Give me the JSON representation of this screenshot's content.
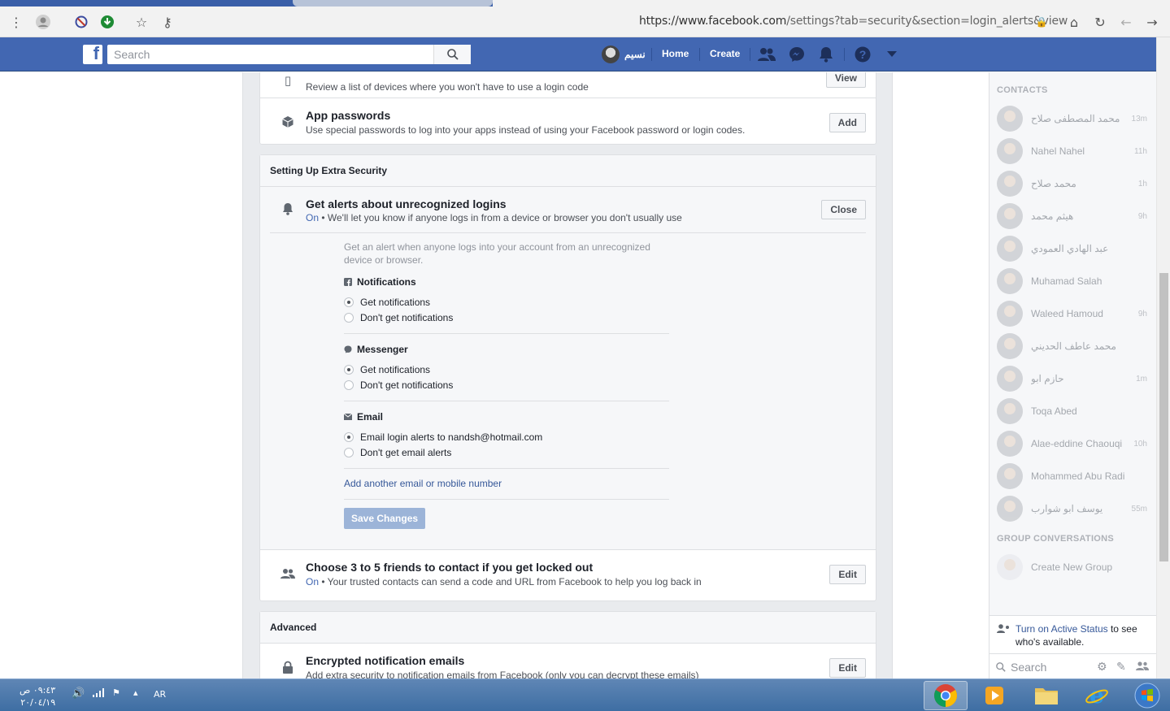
{
  "browser": {
    "url_main": "https://www.facebook.com",
    "url_rest": "/settings?tab=security&section=login_alerts&view"
  },
  "fb": {
    "search_placeholder": "Search",
    "profile_name": "نسيم",
    "nav_home": "Home",
    "nav_create": "Create"
  },
  "top_rows": [
    {
      "desc": "Review a list of devices where you won't have to use a login code",
      "button": "View"
    },
    {
      "title": "App passwords",
      "desc": "Use special passwords to log into your apps instead of using your Facebook password or login codes.",
      "button": "Add"
    }
  ],
  "extra_security": {
    "heading": "Setting Up Extra Security",
    "alerts_title": "Get alerts about unrecognized logins",
    "alerts_status": "On",
    "alerts_desc": " • We'll let you know if anyone logs in from a device or browser you don't usually use",
    "close_button": "Close",
    "intro": "Get an alert when anyone logs into your account from an unrecognized device or browser.",
    "notifications": {
      "title": "Notifications",
      "opt1": "Get notifications",
      "opt2": "Don't get notifications"
    },
    "messenger": {
      "title": "Messenger",
      "opt1": "Get notifications",
      "opt2": "Don't get notifications"
    },
    "email": {
      "title": "Email",
      "opt1": "Email login alerts to nandsh@hotmail.com",
      "opt2": "Don't get email alerts"
    },
    "add_link": "Add another email or mobile number",
    "save_button": "Save Changes",
    "trusted_title": "Choose 3 to 5 friends to contact if you get locked out",
    "trusted_status": "On",
    "trusted_desc": " • Your trusted contacts can send a code and URL from Facebook to help you log back in",
    "trusted_button": "Edit"
  },
  "advanced": {
    "heading": "Advanced",
    "enc_title": "Encrypted notification emails",
    "enc_desc": "Add extra security to notification emails from Facebook (only you can decrypt these emails)",
    "enc_button": "Edit"
  },
  "sidebar": {
    "contacts_heading": "CONTACTS",
    "contacts": [
      {
        "name": "محمد المصطفى صلاح",
        "time": "13m"
      },
      {
        "name": "Nahel Nahel",
        "time": "11h"
      },
      {
        "name": "محمد صلاح",
        "time": "1h"
      },
      {
        "name": "هيثم محمد",
        "time": "9h"
      },
      {
        "name": "عبد الهادي العمودي",
        "time": ""
      },
      {
        "name": "Muhamad Salah",
        "time": ""
      },
      {
        "name": "Waleed Hamoud",
        "time": "9h"
      },
      {
        "name": "محمد عاطف الحديني",
        "time": ""
      },
      {
        "name": "حازم ابو",
        "time": "1m"
      },
      {
        "name": "Toqa Abed",
        "time": ""
      },
      {
        "name": "Alae-eddine Chaouqi",
        "time": "10h"
      },
      {
        "name": "Mohammed Abu Radi",
        "time": ""
      },
      {
        "name": "يوسف ابو شوارب",
        "time": "55m"
      }
    ],
    "groups_heading": "GROUP CONVERSATIONS",
    "create_group": "Create New Group",
    "active_link": "Turn on Active Status",
    "active_rest": " to see who's available.",
    "search_placeholder": "Search"
  },
  "taskbar": {
    "time": "٠٩:٤٣ ص",
    "date": "٢٠/٠٤/١٩",
    "lang": "AR"
  }
}
